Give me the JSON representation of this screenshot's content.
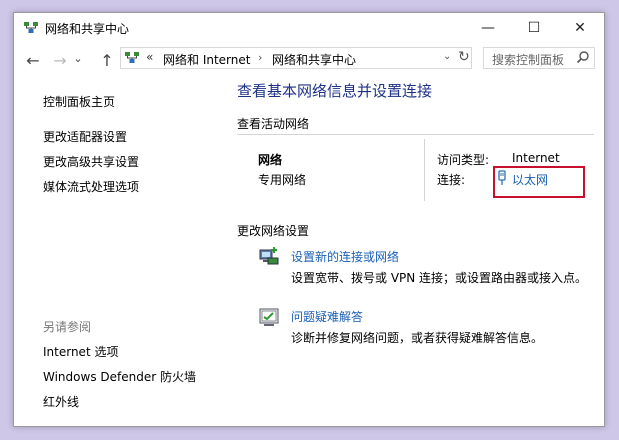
{
  "window": {
    "title": "网络和共享中心",
    "minimize": "—",
    "maximize": "☐",
    "close": "✕"
  },
  "nav": {
    "back": "←",
    "forward": "→",
    "recent": "⌄",
    "up": "↑"
  },
  "address": {
    "chevron": "«",
    "crumbs": [
      "网络和 Internet",
      "网络和共享中心"
    ],
    "separator": "›",
    "dropdown": "⌄",
    "refresh": "↻"
  },
  "search": {
    "placeholder": "搜索控制面板"
  },
  "sidebar": {
    "links": [
      "控制面板主页",
      "更改适配器设置",
      "更改高级共享设置",
      "媒体流式处理选项"
    ],
    "see_also": "另请参阅",
    "see_also_links": [
      "Internet 选项",
      "Windows Defender 防火墙",
      "红外线"
    ]
  },
  "main": {
    "title": "查看基本网络信息并设置连接",
    "active_networks": "查看活动网络",
    "network": {
      "name": "网络",
      "category": "专用网络",
      "access_type_label": "访问类型:",
      "access_type_value": "Internet",
      "connections_label": "连接:",
      "connection_value": "以太网"
    },
    "change_settings": "更改网络设置",
    "tasks": [
      {
        "title": "设置新的连接或网络",
        "desc": "设置宽带、拨号或 VPN 连接；或设置路由器或接入点。",
        "icon": "network-setup-icon"
      },
      {
        "title": "问题疑难解答",
        "desc": "诊断并修复网络问题，或者获得疑难解答信息。",
        "icon": "troubleshoot-icon"
      }
    ]
  },
  "colors": {
    "link": "#1a5fb4",
    "title": "#1e3287",
    "highlight": "#c8102e",
    "desktop": "#cfc7e8"
  }
}
